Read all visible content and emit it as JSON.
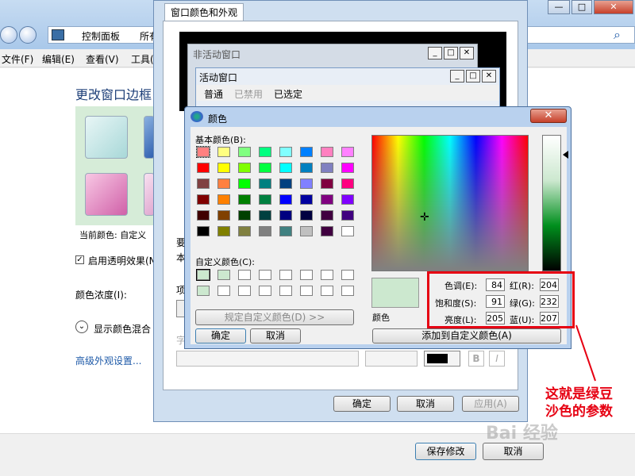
{
  "explorer": {
    "breadcrumb": [
      "控制面板",
      "所有"
    ],
    "menu": [
      "文件(F)",
      "编辑(E)",
      "查看(V)",
      "工具("
    ],
    "heading": "更改窗口边框",
    "current_color": "当前颜色: 自定义",
    "transparency": "启用透明效果(N",
    "intensity": "颜色浓度(I):",
    "mixer": "显示颜色混合",
    "advanced_link": "高级外观设置...",
    "save_button": "保存修改",
    "cancel_button": "取消",
    "window_controls": [
      "—",
      "□",
      "✕"
    ],
    "search_icon": "⌕"
  },
  "appearance_dialog": {
    "tab": "窗口颜色和外观",
    "inactive_title": "非活动窗口",
    "active_title": "活动窗口",
    "menu_items": [
      "普通",
      "已禁用",
      "已选定"
    ],
    "side_labels": [
      "要",
      "本",
      "项",
      "字"
    ],
    "ok_button": "确定",
    "cancel_button": "取消",
    "apply_button": "应用(A)"
  },
  "color_dialog": {
    "title": "颜色",
    "basic_label": "基本颜色(B):",
    "custom_label": "自定义颜色(C):",
    "define_custom": "规定自定义颜色(D) >>",
    "ok_button": "确定",
    "cancel_button": "取消",
    "add_custom": "添加到自定义颜色(A)",
    "color_solid_label": "颜色",
    "hue_label": "色调(E):",
    "hue": "84",
    "sat_label": "饱和度(S):",
    "sat": "91",
    "lum_label": "亮度(L):",
    "lum": "205",
    "red_label": "红(R):",
    "red": "204",
    "green_label": "绿(G):",
    "green": "232",
    "blue_label": "蓝(U):",
    "blue": "207",
    "close": "✕",
    "basic_colors": [
      [
        "#ff8080",
        "#ffff80",
        "#80ff80",
        "#00ff80",
        "#80ffff",
        "#0080ff",
        "#ff80c0",
        "#ff80ff"
      ],
      [
        "#ff0000",
        "#ffff00",
        "#80ff00",
        "#00ff40",
        "#00ffff",
        "#0080c0",
        "#8080c0",
        "#ff00ff"
      ],
      [
        "#804040",
        "#ff8040",
        "#00ff00",
        "#008080",
        "#004080",
        "#8080ff",
        "#800040",
        "#ff0080"
      ],
      [
        "#800000",
        "#ff8000",
        "#008000",
        "#008040",
        "#0000ff",
        "#0000a0",
        "#800080",
        "#8000ff"
      ],
      [
        "#400000",
        "#804000",
        "#004000",
        "#004040",
        "#000080",
        "#000040",
        "#400040",
        "#400080"
      ],
      [
        "#000000",
        "#808000",
        "#808040",
        "#808080",
        "#408080",
        "#c0c0c0",
        "#400040",
        "#ffffff"
      ]
    ],
    "custom_colors": [
      [
        "#cce8cf",
        "#cce8cf",
        "#ffffff",
        "#ffffff",
        "#ffffff",
        "#ffffff",
        "#ffffff",
        "#ffffff"
      ],
      [
        "#cce8cf",
        "#ffffff",
        "#ffffff",
        "#ffffff",
        "#ffffff",
        "#ffffff",
        "#ffffff",
        "#ffffff"
      ]
    ],
    "selected_color": "#cce8cf"
  },
  "annotation": {
    "line1": "这就是绿豆",
    "line2": "沙色的参数",
    "color": "#e60012"
  },
  "watermark": "Bai 经验"
}
